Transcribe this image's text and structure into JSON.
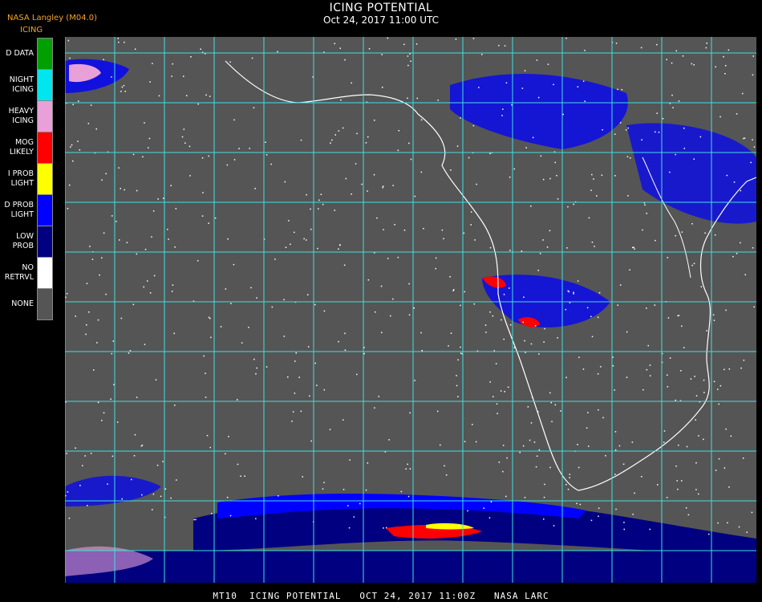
{
  "header": {
    "title": "ICING POTENTIAL",
    "subtitle": "Oct 24, 2017 11:00 UTC",
    "credit": "NASA Langley (M04.0)"
  },
  "legend": {
    "title": "ICING",
    "items": [
      {
        "label": "D DATA",
        "color": "#00a000"
      },
      {
        "label": "NIGHT\nICING",
        "color": "#00e5ee"
      },
      {
        "label": "HEAVY\nICING",
        "color": "#e8a0d8"
      },
      {
        "label": "MOG\nLIKELY",
        "color": "#ff0000"
      },
      {
        "label": "I PROB\nLIGHT",
        "color": "#ffff00"
      },
      {
        "label": "D PROB\nLIGHT",
        "color": "#0000ff"
      },
      {
        "label": "LOW\nPROB",
        "color": "#000080"
      },
      {
        "label": "NO\nRETRVL",
        "color": "#ffffff"
      },
      {
        "label": "NONE",
        "color": "#555555"
      }
    ]
  },
  "map": {
    "background_color": "#555555",
    "grid_color": "#40e0e0",
    "coastline_color": "#ffffff"
  },
  "footer": {
    "text": "MT10  ICING POTENTIAL   OCT 24, 2017 11:00Z   NASA LARC"
  }
}
